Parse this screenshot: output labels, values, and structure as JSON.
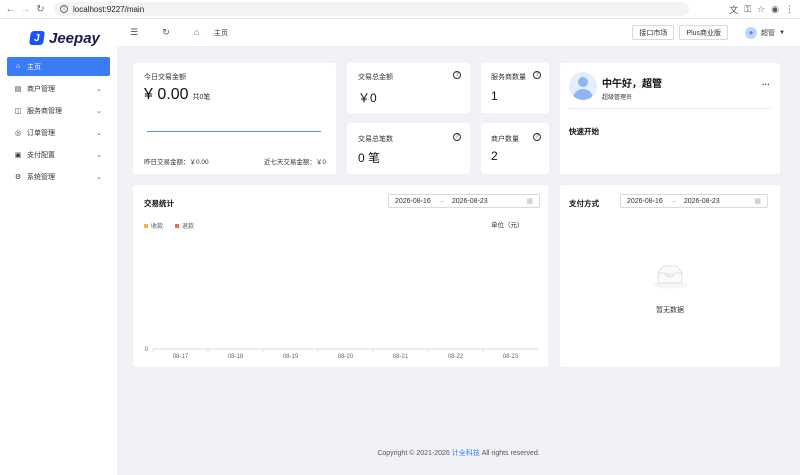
{
  "browser": {
    "url": "localhost:9227/main"
  },
  "brand": {
    "name": "Jeepay",
    "mark": "J"
  },
  "sidebar": {
    "items": [
      {
        "label": "主页",
        "icon": "⌂",
        "active": true,
        "expandable": false
      },
      {
        "label": "商户管理",
        "icon": "▤",
        "active": false,
        "expandable": true
      },
      {
        "label": "服务商管理",
        "icon": "◫",
        "active": false,
        "expandable": true
      },
      {
        "label": "订单管理",
        "icon": "◎",
        "active": false,
        "expandable": true
      },
      {
        "label": "支付配置",
        "icon": "▣",
        "active": false,
        "expandable": true
      },
      {
        "label": "系统管理",
        "icon": "⚙",
        "active": false,
        "expandable": true
      }
    ]
  },
  "topbar": {
    "tab_label": "主页",
    "btn_market": "接口市场",
    "btn_plus": "Plus商业版",
    "user_name": "超管"
  },
  "today": {
    "label": "今日交易金额",
    "amount": "¥ 0.00",
    "count": "共0笔",
    "yesterday": "昨日交易金额：￥0.00",
    "seven_days": "近七天交易金额：￥0"
  },
  "stats": {
    "total_amount_label": "交易总金额",
    "total_amount": "￥0",
    "total_count_label": "交易总笔数",
    "total_count": "0 笔",
    "isv_count_label": "服务商数量",
    "isv_count": "1",
    "mch_count_label": "商户数量",
    "mch_count": "2"
  },
  "profile": {
    "greeting": "中午好，超管",
    "role": "超级管理员",
    "more": "···",
    "quick_start": "快速开始"
  },
  "trade_chart": {
    "title": "交易统计",
    "date_from": "2026-08-16",
    "date_to": "2026-08-23",
    "unit": "单位（元）",
    "legend_income": "收款",
    "legend_refund": "退款",
    "color_income": "#f7b84b",
    "color_refund": "#e8704a"
  },
  "chart_data": {
    "type": "line",
    "x": [
      "08-17",
      "08-18",
      "08-19",
      "08-20",
      "08-21",
      "08-22",
      "08-23"
    ],
    "series": [
      {
        "name": "收款",
        "values": [
          0,
          0,
          0,
          0,
          0,
          0,
          0
        ]
      },
      {
        "name": "退款",
        "values": [
          0,
          0,
          0,
          0,
          0,
          0,
          0
        ]
      }
    ],
    "ylabel": "单位（元）",
    "y_ticks": [
      "0"
    ]
  },
  "pay_method": {
    "title": "支付方式",
    "date_from": "2026-08-16",
    "date_to": "2026-08-23",
    "empty_text": "暂无数据"
  },
  "footer": {
    "prefix": "Copyright © 2021-2026",
    "company": "计全科技",
    "suffix": "All rights reserved."
  }
}
